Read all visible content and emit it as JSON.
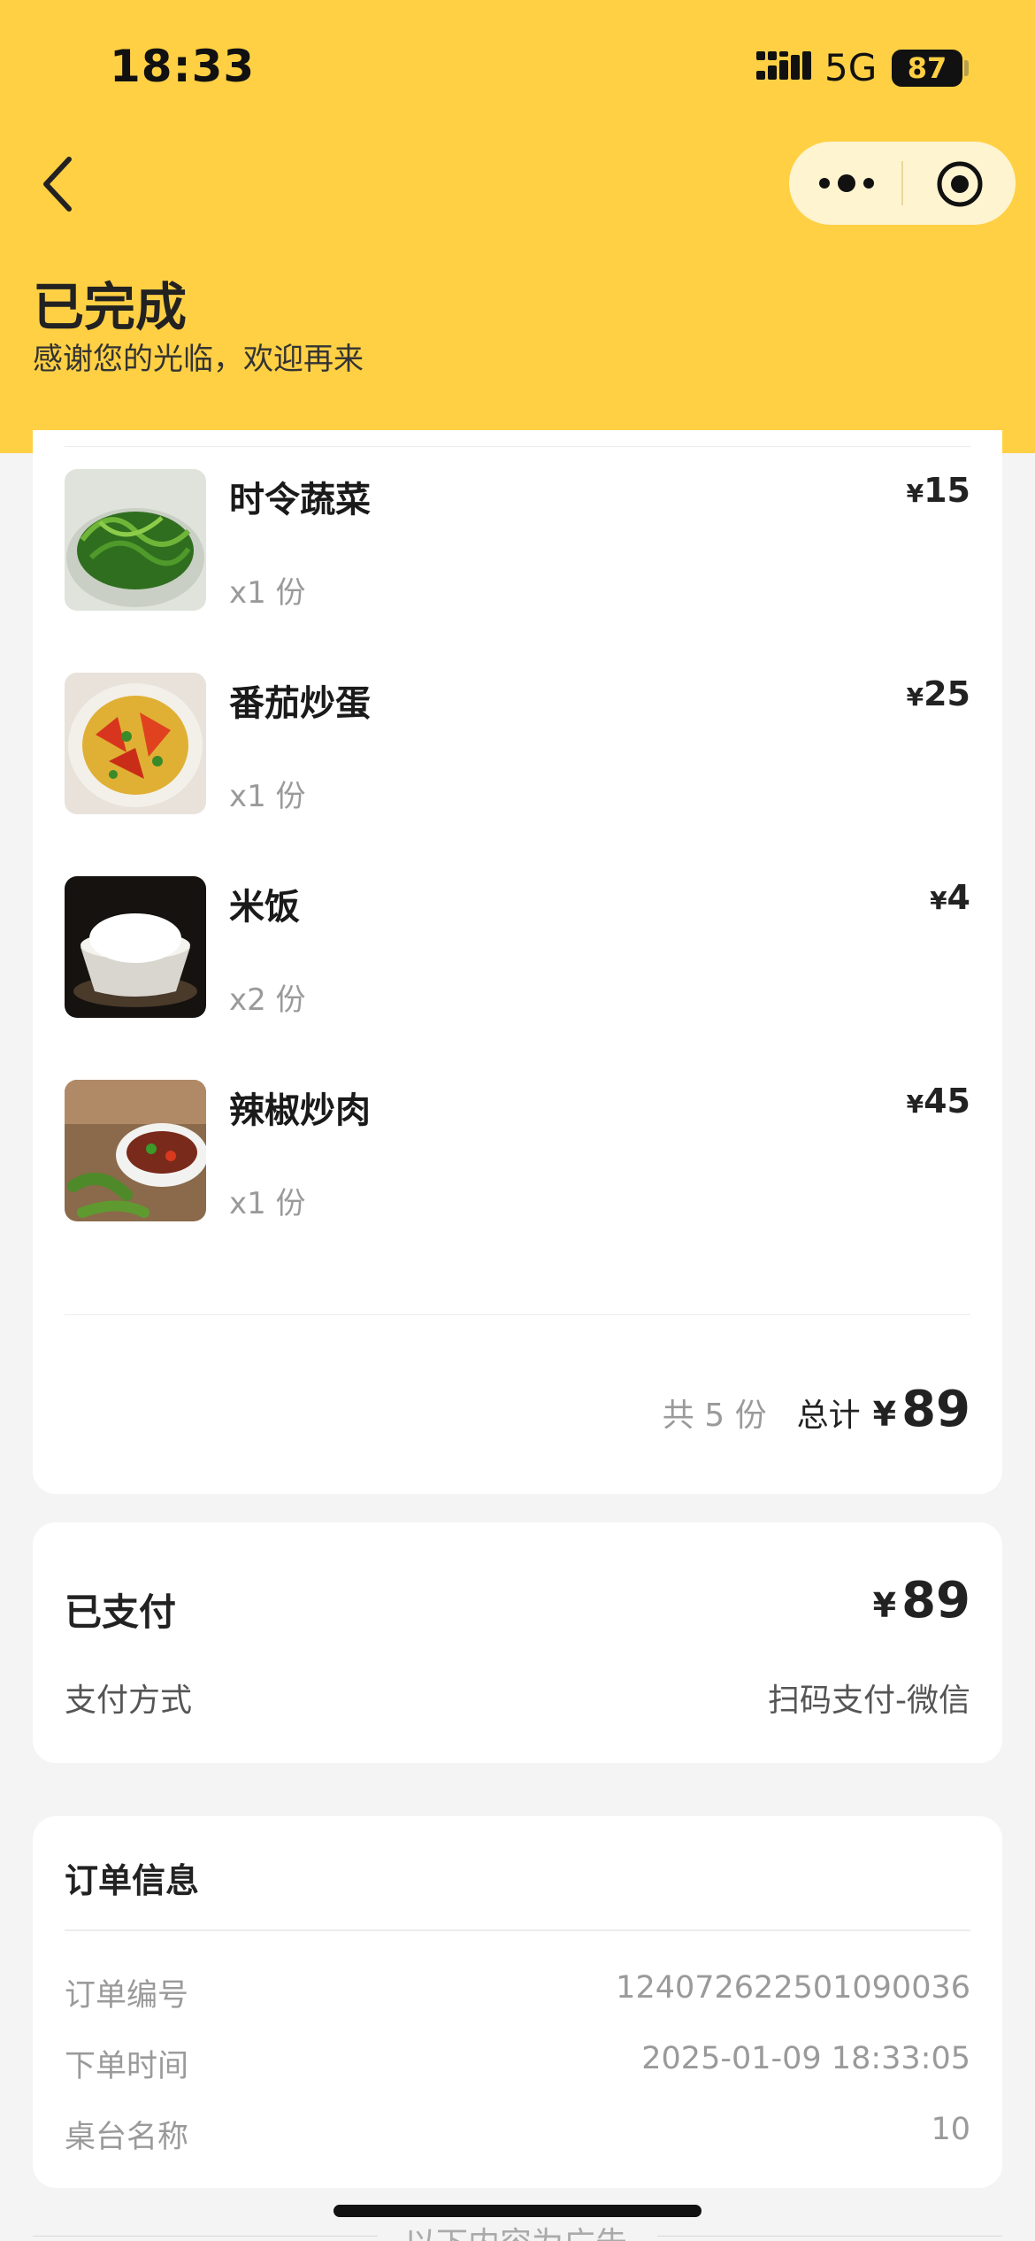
{
  "status_bar": {
    "time": "18:33",
    "network": "5G",
    "battery": "87"
  },
  "header": {
    "title": "已完成",
    "subtitle": "感谢您的光临，欢迎再来",
    "back_icon": "chevron-left-icon",
    "more_icon": "more-dots-icon",
    "close_icon": "target-close-icon"
  },
  "items": [
    {
      "name": "时令蔬菜",
      "qty": "x1 份",
      "currency": "¥",
      "price": "15",
      "image": "green-vegetables"
    },
    {
      "name": "番茄炒蛋",
      "qty": "x1 份",
      "currency": "¥",
      "price": "25",
      "image": "tomato-egg"
    },
    {
      "name": "米饭",
      "qty": "x2 份",
      "currency": "¥",
      "price": "4",
      "image": "rice-bowl"
    },
    {
      "name": "辣椒炒肉",
      "qty": "x1 份",
      "currency": "¥",
      "price": "45",
      "image": "pepper-pork"
    }
  ],
  "summary": {
    "count": "共 5 份",
    "total_label": "总计",
    "currency": "¥",
    "total": "89"
  },
  "payment": {
    "status": "已支付",
    "currency": "¥",
    "amount": "89",
    "method_label": "支付方式",
    "method_value": "扫码支付-微信"
  },
  "order": {
    "title": "订单信息",
    "rows": [
      {
        "key": "订单编号",
        "value": "124072622501090036"
      },
      {
        "key": "下单时间",
        "value": "2025-01-09 18:33:05"
      },
      {
        "key": "桌台名称",
        "value": "10"
      }
    ]
  },
  "ad": {
    "text": "以下内容为广告"
  },
  "colors": {
    "header": "#ffd044",
    "background": "#f4f4f4",
    "card": "#ffffff"
  }
}
